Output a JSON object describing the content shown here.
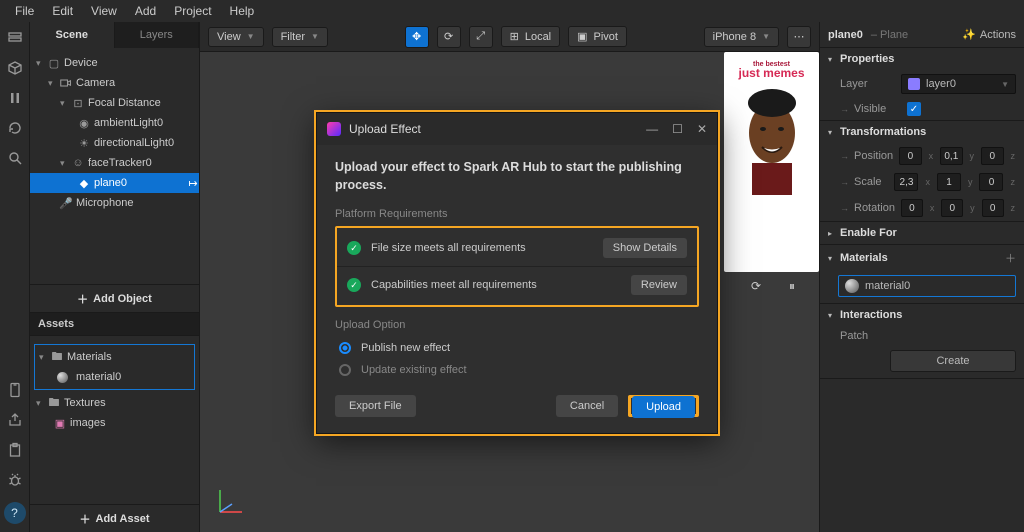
{
  "menu": [
    "File",
    "Edit",
    "View",
    "Add",
    "Project",
    "Help"
  ],
  "tabs": {
    "scene": "Scene",
    "layers": "Layers"
  },
  "scene": {
    "device": "Device",
    "camera": "Camera",
    "focal": "Focal Distance",
    "ambient": "ambientLight0",
    "dirlight": "directionalLight0",
    "tracker": "faceTracker0",
    "plane": "plane0",
    "mic": "Microphone"
  },
  "add_object": "Add Object",
  "assets_title": "Assets",
  "assets": {
    "materials": "Materials",
    "material0": "material0",
    "textures": "Textures",
    "images": "images"
  },
  "add_asset": "Add Asset",
  "toolbar": {
    "view": "View",
    "filter": "Filter",
    "local": "Local",
    "pivot": "Pivot",
    "device": "iPhone 8"
  },
  "meme": {
    "small": "the bestest",
    "big": "just memes"
  },
  "inspector": {
    "name": "plane0",
    "type": "– Plane",
    "actions": "Actions",
    "properties": "Properties",
    "layer": "Layer",
    "layer0": "layer0",
    "visible": "Visible",
    "transformations": "Transformations",
    "position": "Position",
    "scale": "Scale",
    "rotation": "Rotation",
    "pos": [
      "0",
      "0,1",
      "0"
    ],
    "scale_v": [
      "2,3",
      "1",
      "0"
    ],
    "rot": [
      "0",
      "0",
      "0"
    ],
    "enable_for": "Enable For",
    "materials": "Materials",
    "material0": "material0",
    "interactions": "Interactions",
    "patch": "Patch",
    "create": "Create"
  },
  "dialog": {
    "title": "Upload Effect",
    "message": "Upload your effect to Spark AR Hub to start the publishing process.",
    "platform_req": "Platform Requirements",
    "req1": "File size meets all requirements",
    "show_details": "Show Details",
    "req2": "Capabilities meet all requirements",
    "review": "Review",
    "upload_option": "Upload Option",
    "publish_new": "Publish new effect",
    "update_existing": "Update existing effect",
    "export": "Export File",
    "cancel": "Cancel",
    "upload": "Upload"
  }
}
